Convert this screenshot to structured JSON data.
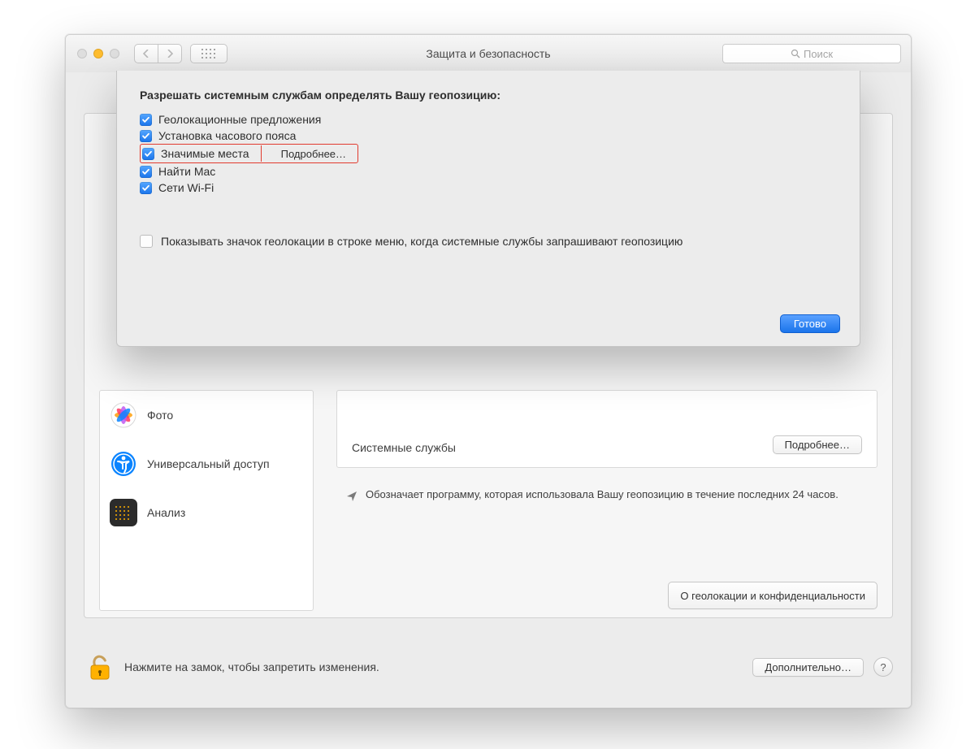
{
  "window": {
    "title": "Защита и безопасность",
    "search_placeholder": "Поиск"
  },
  "sheet": {
    "heading": "Разрешать системным службам определять Вашу геопозицию:",
    "items": [
      {
        "label": "Геолокационные предложения",
        "checked": true,
        "highlighted": false,
        "details_btn": null
      },
      {
        "label": "Установка часового пояса",
        "checked": true,
        "highlighted": false,
        "details_btn": null
      },
      {
        "label": "Значимые места",
        "checked": true,
        "highlighted": true,
        "details_btn": "Подробнее…"
      },
      {
        "label": "Найти Mac",
        "checked": true,
        "highlighted": false,
        "details_btn": null
      },
      {
        "label": "Сети Wi-Fi",
        "checked": true,
        "highlighted": false,
        "details_btn": null
      }
    ],
    "show_menu_icon": {
      "checked": false,
      "label": "Показывать значок геолокации в строке меню, когда системные службы запрашивают геопозицию"
    },
    "done": "Готово"
  },
  "sidebar": {
    "items": [
      {
        "label": "Фото"
      },
      {
        "label": "Универсальный доступ"
      },
      {
        "label": "Анализ"
      }
    ]
  },
  "details": {
    "system_services": "Системные службы",
    "details_btn": "Подробнее…",
    "note": "Обозначает программу, которая использовала Вашу геопозицию в течение последних 24 часов.",
    "about_btn": "О геолокации и конфиденциальности"
  },
  "lockbar": {
    "text": "Нажмите на замок, чтобы запретить изменения.",
    "advanced": "Дополнительно…",
    "help": "?"
  }
}
